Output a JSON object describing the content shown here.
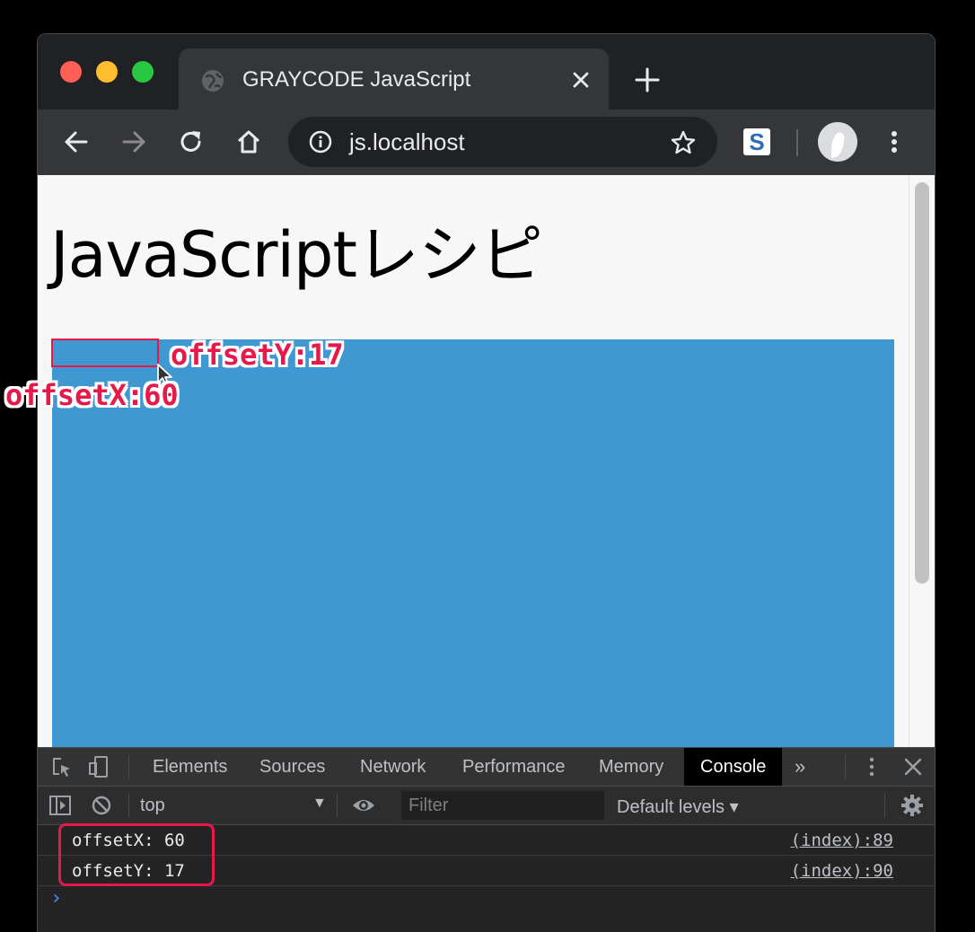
{
  "browser": {
    "tab_title": "GRAYCODE JavaScript",
    "url": "js.localhost",
    "extension_label": "S"
  },
  "page": {
    "heading": "JavaScriptレシピ"
  },
  "annotations": {
    "offset_y_label": "offsetY:17",
    "offset_x_label": "offsetX:60"
  },
  "devtools": {
    "tabs": [
      "Elements",
      "Sources",
      "Network",
      "Performance",
      "Memory",
      "Console"
    ],
    "active_tab": "Console",
    "overflow": "»",
    "context": "top",
    "filter_placeholder": "Filter",
    "levels": "Default levels ▾",
    "logs": [
      {
        "message": "offsetX: 60",
        "source": "(index):89"
      },
      {
        "message": "offsetY: 17",
        "source": "(index):90"
      }
    ],
    "prompt": "›"
  },
  "colors": {
    "box_fill": "#4098d3",
    "annotation": "#e6194b",
    "page_bg": "#f7f7f7"
  },
  "icons": [
    "globe-icon",
    "close-icon",
    "plus-icon",
    "back-icon",
    "forward-icon",
    "reload-icon",
    "home-icon",
    "info-icon",
    "star-icon",
    "profile-icon",
    "more-vert-icon",
    "inspect-icon",
    "device-icon",
    "sidebar-icon",
    "clear-icon",
    "eye-icon",
    "gear-icon"
  ]
}
